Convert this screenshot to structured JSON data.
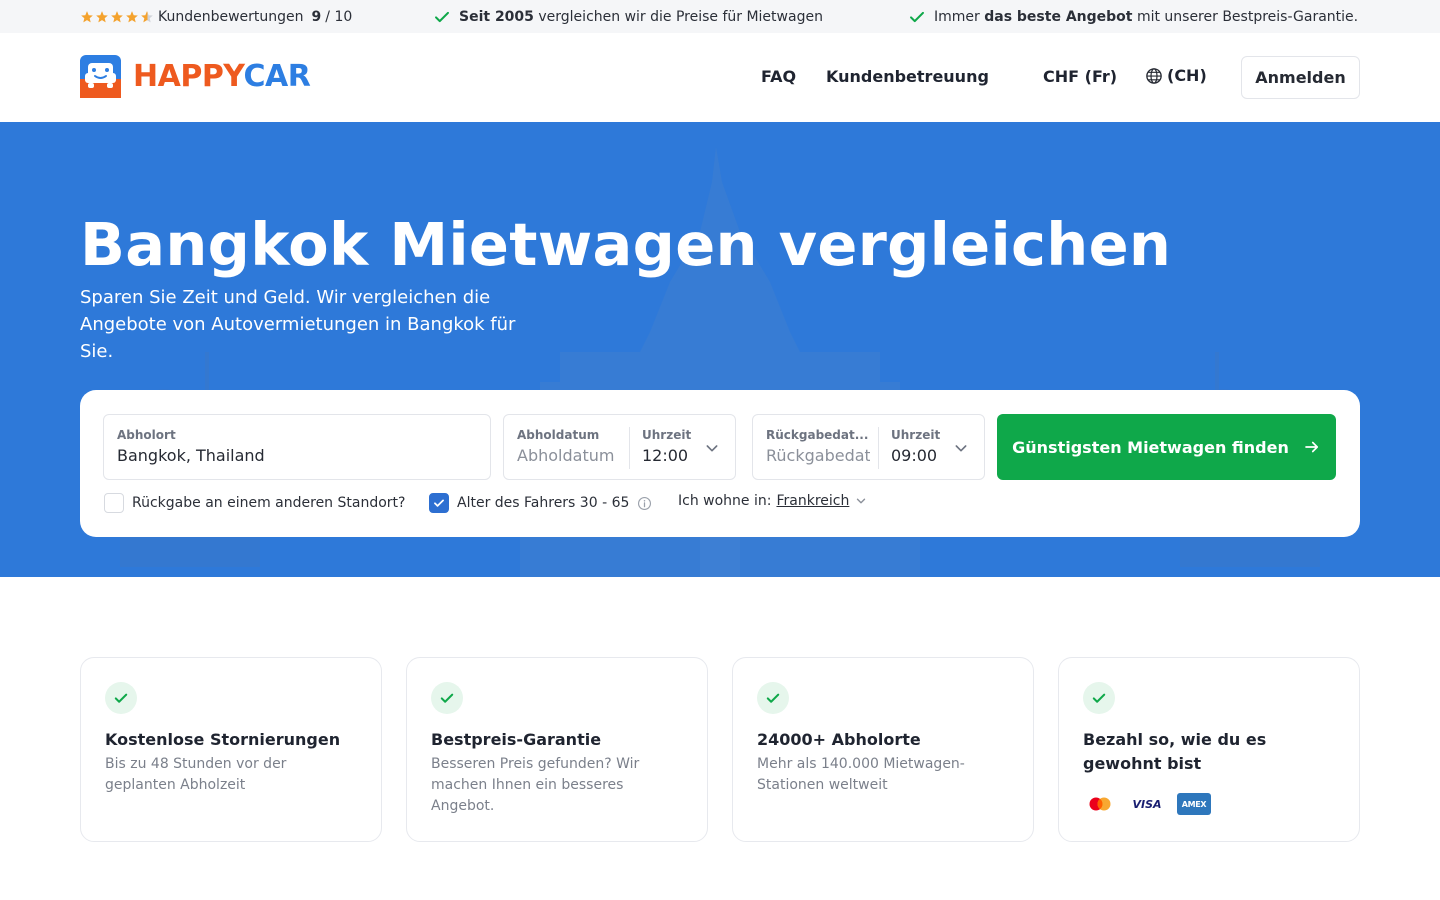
{
  "topbar": {
    "rating_label": "Kundenbewertungen",
    "rating_score": "9",
    "rating_sep": "/ 10",
    "since_bold": "Seit 2005",
    "since_rest": "vergleichen wir die Preise für Mietwagen",
    "best_pre": "Immer",
    "best_bold": "das beste Angebot",
    "best_rest": "mit unserer Bestpreis-Garantie."
  },
  "header": {
    "logo_happy": "HAPPY",
    "logo_car": "CAR",
    "nav_faq": "FAQ",
    "nav_support": "Kundenbetreuung",
    "currency": "CHF (Fr)",
    "language": "(CH)",
    "login": "Anmelden"
  },
  "hero": {
    "title": "Bangkok Mietwagen vergleichen",
    "subtitle": "Sparen Sie Zeit und Geld. Wir vergleichen die Angebote von Autovermietungen in Bangkok für Sie."
  },
  "search": {
    "pickup_label": "Abholort",
    "pickup_value": "Bangkok, Thailand",
    "pickup_date_label": "Abholdatum",
    "pickup_date_placeholder": "Abholdatum",
    "pickup_time_label": "Uhrzeit",
    "pickup_time_value": "12:00",
    "return_date_label": "Rückgabedat...",
    "return_date_placeholder": "Rückgabedat",
    "return_time_label": "Uhrzeit",
    "return_time_value": "09:00",
    "submit": "Günstigsten Mietwagen finden",
    "other_location": "Rückgabe an einem anderen Standort?",
    "driver_age": "Alter des Fahrers 30 - 65",
    "residence_label": "Ich wohne in:",
    "residence_value": "Frankreich"
  },
  "features": [
    {
      "title": "Kostenlose Stornierungen",
      "desc": "Bis zu 48 Stunden vor der geplanten Abholzeit"
    },
    {
      "title": "Bestpreis-Garantie",
      "desc": "Besseren Preis gefunden? Wir machen Ihnen ein besseres Angebot."
    },
    {
      "title": "24000+ Abholorte",
      "desc": "Mehr als 140.000 Mietwagen-Stationen weltweit"
    },
    {
      "title": "Bezahl so, wie du es gewohnt bist",
      "desc": ""
    }
  ],
  "payments": {
    "visa": "VISA",
    "amex": "AMEX"
  },
  "colors": {
    "brand_orange": "#ee5a1f",
    "brand_blue": "#2d7ee2",
    "hero_blue": "#2e79d9",
    "cta_green": "#0fa84a",
    "check_green": "#0fa84a",
    "star_orange": "#f4a22d"
  },
  "icons": {
    "rating": "star-icon",
    "check": "check-icon",
    "globe": "globe-icon",
    "chevron": "chevron-down-icon",
    "arrow": "arrow-right-icon",
    "info": "info-icon"
  }
}
